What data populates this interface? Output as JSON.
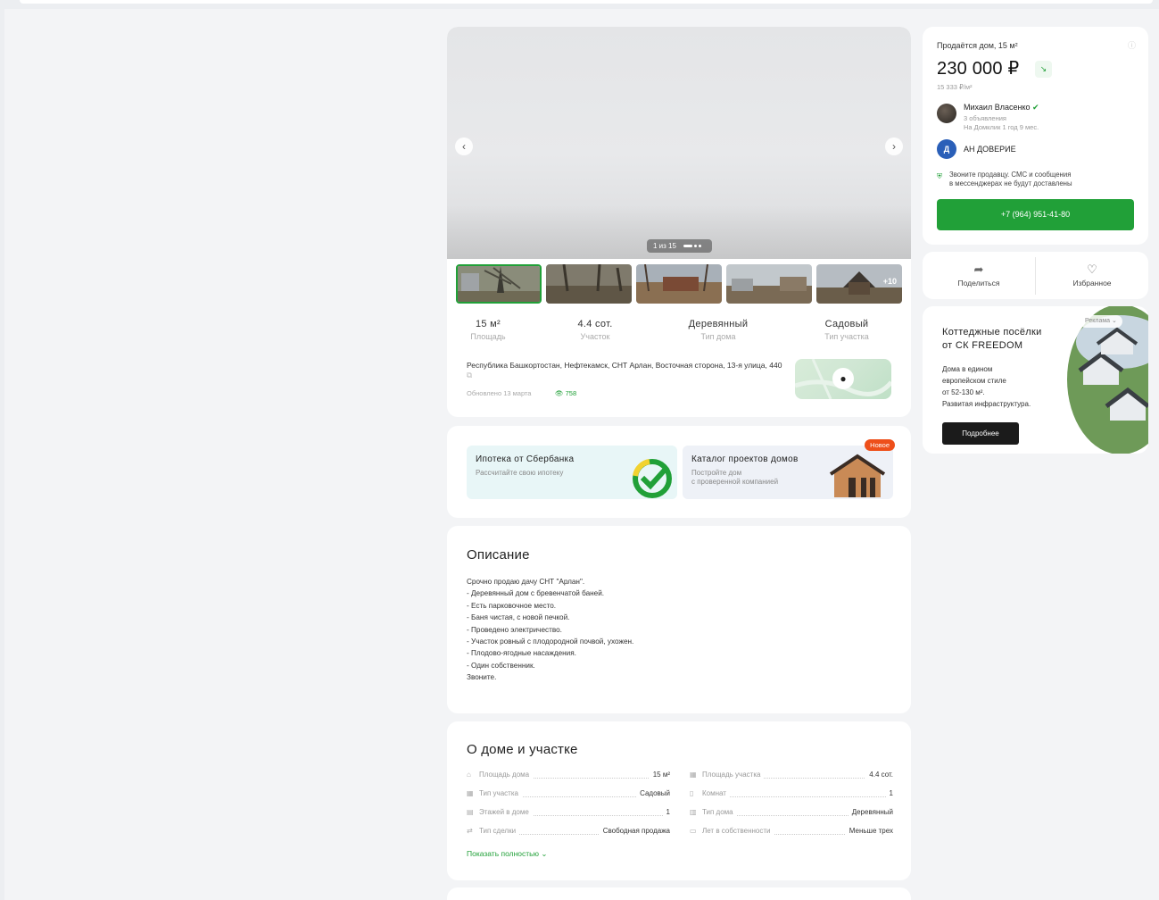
{
  "gallery": {
    "counter": "1 из 15",
    "more_photos": "+10",
    "specs": [
      {
        "value": "15 м²",
        "label": "Площадь"
      },
      {
        "value": "4.4 сот.",
        "label": "Участок"
      },
      {
        "value": "Деревянный",
        "label": "Тип дома"
      },
      {
        "value": "Садовый",
        "label": "Тип участка"
      }
    ],
    "address": "Республика Башкортостан, Нефтекамск, СНТ Арлан, Восточная сторона, 13-я улица, 440",
    "updated": "Обновлено 13 марта",
    "views": "758"
  },
  "promo": {
    "mortgage_title": "Ипотека от Сбербанка",
    "mortgage_sub": "Рассчитайте свою ипотеку",
    "catalog_title": "Каталог проектов домов",
    "catalog_sub_1": "Постройте дом",
    "catalog_sub_2": "с проверенной компанией",
    "new_badge": "Новое"
  },
  "description": {
    "title": "Описание",
    "lines": [
      "Срочно продаю дачу СНТ \"Арлан\".",
      "- Деревянный дом с бревенчатой баней.",
      "- Есть парковочное место.",
      "- Баня чистая, с новой печкой.",
      "- Проведено электричество.",
      "- Участок ровный с плодородной почвой, ухожен.",
      "- Плодово-ягодные насаждения.",
      "- Один собственник.",
      "Звоните."
    ]
  },
  "about": {
    "title": "О доме и участке",
    "left": [
      {
        "key": "Площадь дома",
        "value": "15 м²"
      },
      {
        "key": "Тип участка",
        "value": "Садовый"
      },
      {
        "key": "Этажей в доме",
        "value": "1"
      },
      {
        "key": "Тип сделки",
        "value": "Свободная продажа"
      }
    ],
    "right": [
      {
        "key": "Площадь участка",
        "value": "4.4 сот."
      },
      {
        "key": "Комнат",
        "value": "1"
      },
      {
        "key": "Тип дома",
        "value": "Деревянный"
      },
      {
        "key": "Лет в собственности",
        "value": "Меньше трех"
      }
    ],
    "show_all": "Показать полностью"
  },
  "price_card": {
    "title": "Продаётся дом, 15 м²",
    "price": "230 000 ₽",
    "per_meter": "15 333 ₽/м²",
    "seller_name": "Михаил Власенко",
    "seller_ads": "3 объявления",
    "seller_since": "На Домклик 1 год 9 мес.",
    "agency": "АН ДОВЕРИЕ",
    "warning_1": "Звоните продавцу. СМС и сообщения",
    "warning_2": "в мессенджерах не будут доставлены",
    "phone": "+7 (964) 951-41-80"
  },
  "actions": {
    "share": "Поделиться",
    "favorite": "Избранное"
  },
  "ad": {
    "title_1": "Коттеджные посёлки",
    "title_2": "от СК FREEDOM",
    "text": [
      "Дома в едином",
      "европейском стиле",
      "от 52-130 м².",
      "Развитая инфраструктура."
    ],
    "button": "Подробнее",
    "badge": "Реклама"
  },
  "colors": {
    "accent": "#21a038",
    "new_badge": "#ee4f1a"
  }
}
